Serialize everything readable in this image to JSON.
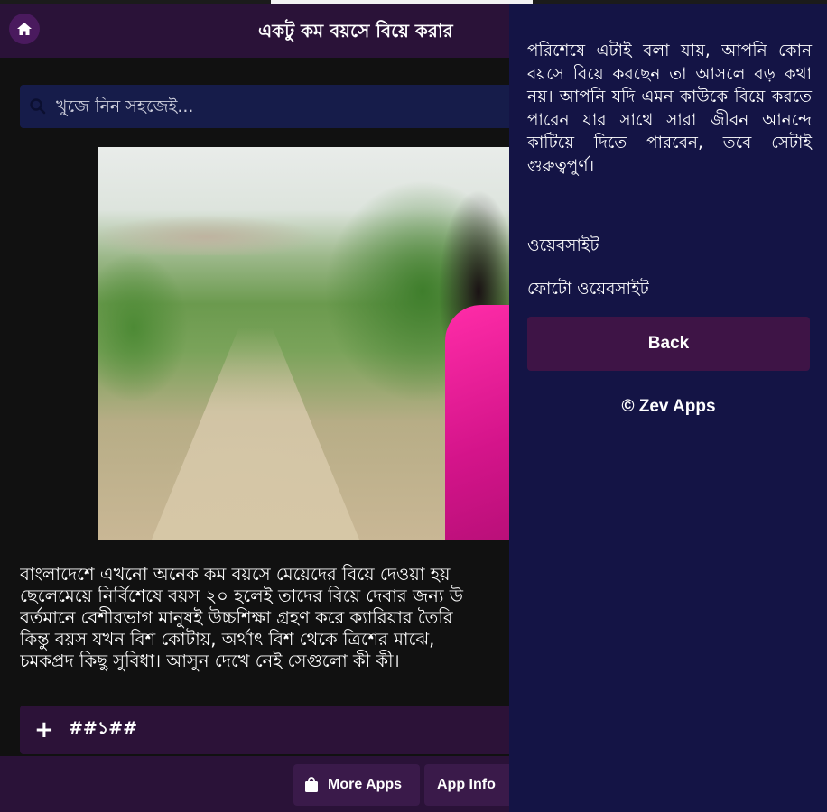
{
  "header": {
    "title": "একটু কম বয়সে বিয়ে করার",
    "home_icon": "home-icon"
  },
  "search": {
    "placeholder": "খুজে নিন সহজেই...",
    "icon": "search-icon"
  },
  "article": {
    "lines": [
      "বাংলাদেশে এখনো অনেক কম বয়সে মেয়েদের বিয়ে দেওয়া হয়",
      "ছেলেমেয়ে নির্বিশেষে বয়স ২০ হলেই তাদের বিয়ে দেবার জন্য উ",
      "বর্তমানে বেশীরভাগ মানুষই উচ্চশিক্ষা গ্রহণ করে ক্যারিয়ার তৈরি",
      "কিন্তু বয়স যখন বিশ কোটায়, অর্থাৎ বিশ থেকে ত্রিশের মাঝে, ",
      "চমকপ্রদ কিছু সুবিধা। আসুন দেখে নেই সেগুলো কী কী।"
    ]
  },
  "accordion": {
    "label": "##১##"
  },
  "footer": {
    "more_apps": "More Apps",
    "app_info": "App Info"
  },
  "panel": {
    "text": "পরিশেষে এটাই বলা যায়, আপনি কোন বয়সে বিয়ে করছেন তা আসলে বড় কথা নয়। আপনি যদি এমন কাউকে বিয়ে করতে পারেন যার সাথে সারা জীবন আনন্দে কাটিয়ে দিতে পারবেন, তবে সেটাই গুরুত্বপুর্ণ।",
    "link1": "ওয়েবসাইট",
    "link2": "ফোটো ওয়েবসাইট",
    "back": "Back",
    "copyright": "© Zev Apps"
  },
  "colors": {
    "header_bg": "#2a1238",
    "page_bg": "#111111",
    "search_bg": "#161c4a",
    "panel_bg": "#141445",
    "button_bg": "#3e1446"
  }
}
